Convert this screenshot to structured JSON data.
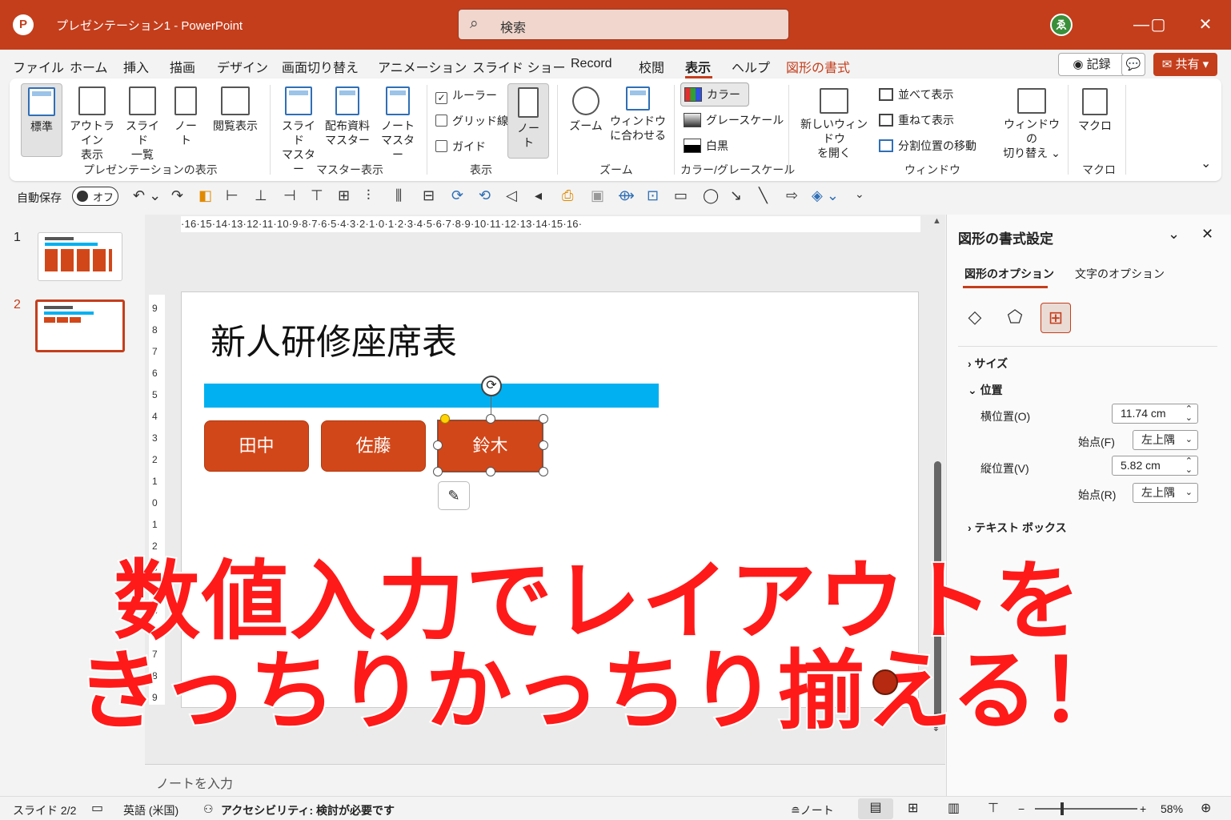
{
  "titlebar": {
    "logo": "P",
    "doc_title": "プレゼンテーション1  -  PowerPoint",
    "search_placeholder": "検索",
    "search_icon": "search-icon",
    "avatar_initial": "ゑ",
    "minimize": "—",
    "maximize": "▢",
    "close": "✕"
  },
  "tabs": [
    "ファイル",
    "ホーム",
    "挿入",
    "描画",
    "デザイン",
    "画面切り替え",
    "アニメーション",
    "スライド ショー",
    "Record",
    "校閲",
    "表示",
    "ヘルプ",
    "図形の書式"
  ],
  "header_buttons": {
    "record": "◉ 記録",
    "comment": "💬",
    "share": "✉ 共有 ▾"
  },
  "ribbon": {
    "presentation_views": {
      "group": "プレゼンテーションの表示",
      "normal": "標準",
      "outline_1": "アウトライン",
      "outline_2": "表示",
      "sorter_1": "スライド",
      "sorter_2": "一覧",
      "notes_1": "ノー",
      "notes_2": "ト",
      "reading": "閲覧表示"
    },
    "master_views": {
      "group": "マスター表示",
      "slide_master_1": "スライド",
      "slide_master_2": "マスター",
      "handout_1": "配布資料",
      "handout_2": "マスター",
      "notes_master_1": "ノート",
      "notes_master_2": "マスター"
    },
    "show": {
      "group": "表示",
      "ruler": "ルーラー",
      "gridlines": "グリッド線",
      "guides": "ガイド",
      "notes_1": "ノー",
      "notes_2": "ト",
      "ruler_checked": "✓"
    },
    "zoom": {
      "group": "ズーム",
      "zoom": "ズーム",
      "fit_1": "ウィンドウ",
      "fit_2": "に合わせる"
    },
    "color": {
      "group": "カラー/グレースケール",
      "color": "カラー",
      "grayscale": "グレースケール",
      "bw": "白黒"
    },
    "window": {
      "group": "ウィンドウ",
      "new_1": "新しいウィンドウ",
      "new_2": "を開く",
      "arrange": "並べて表示",
      "cascade": "重ねて表示",
      "split": "分割位置の移動",
      "switch_1": "ウィンドウの",
      "switch_2": "切り替え ⌄"
    },
    "macros": {
      "group": "マクロ",
      "macro": "マクロ"
    },
    "collapse": "⌄"
  },
  "qat": {
    "autosave": "自動保存",
    "autosave_state": "オフ",
    "icons": [
      "↶ ⌄",
      "↷",
      "◧",
      "⊢",
      "⊥",
      "⊣",
      "⊤",
      "⊞",
      "⫶",
      "⫼",
      "⊟",
      "⟳",
      "⟲",
      "◁",
      "◂",
      "⎙",
      "▣",
      "⟴",
      "⊡",
      "▭",
      "◯",
      "↘",
      "╲",
      "⇨",
      "◈ ⌄",
      "⌄"
    ]
  },
  "slides": [
    {
      "number": "1"
    },
    {
      "number": "2"
    }
  ],
  "ruler_h": "·16·15·14·13·12·11·10·9·8·7·6·5·4·3·2·1·0·1·2·3·4·5·6·7·8·9·10·11·12·13·14·15·16·",
  "ruler_v": [
    "9",
    "8",
    "7",
    "6",
    "5",
    "4",
    "3",
    "2",
    "1",
    "0",
    "1",
    "2",
    "3",
    "4",
    "5",
    "6",
    "7",
    "8",
    "9"
  ],
  "slide": {
    "title": "新人研修座席表",
    "seats": [
      "田中",
      "佐藤",
      "鈴木"
    ],
    "designer_icon": "✎",
    "rotate_icon": "⟳"
  },
  "notes_placeholder": "ノートを入力",
  "format_pane": {
    "title": "図形の書式設定",
    "collapse": "⌄",
    "close": "✕",
    "tabs": [
      "図形のオプション",
      "文字のオプション"
    ],
    "icons": [
      "◇",
      "⬠",
      "⊞"
    ],
    "sections": {
      "size": "› サイズ",
      "position": "⌄ 位置",
      "textbox": "› テキスト ボックス"
    },
    "horizontal_label": "横位置(O)",
    "horizontal_value": "11.74 cm",
    "from_h_label": "始点(F)",
    "from_h_value": "左上隅",
    "vertical_label": "縦位置(V)",
    "vertical_value": "5.82 cm",
    "from_v_label": "始点(R)",
    "from_v_value": "左上隅",
    "spin": "⌃⌄",
    "dropdown": "⌄"
  },
  "statusbar": {
    "slide": "スライド 2/2",
    "lang": "英語 (米国)",
    "accessibility": "アクセシビリティ: 検討が必要です",
    "notes": "≘ノート",
    "zoom": "58%",
    "minus": "−",
    "plus": "+"
  },
  "overlay": {
    "line1": "数値入力でレイアウトを",
    "line2": "きっちりかっちり揃える！"
  },
  "colors": {
    "accent": "#c43e1c",
    "shape": "#d24719",
    "bar": "#00b0f0",
    "overlay_text": "#ff1a1a"
  }
}
